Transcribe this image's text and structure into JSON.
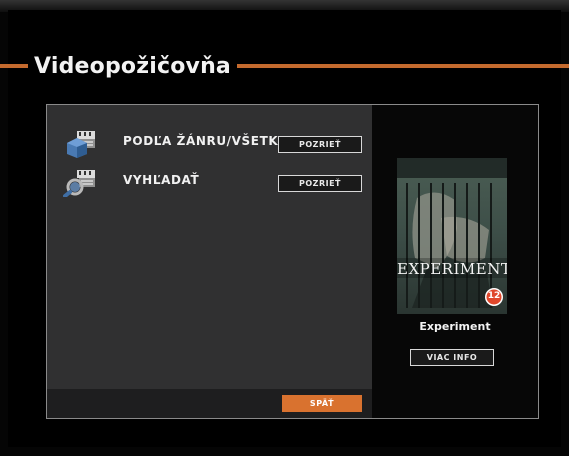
{
  "app": {
    "title": "Videopožičovňa"
  },
  "menu": {
    "items": [
      {
        "label": "PODĽA ŽÁNRU/VŠETKO",
        "button": "POZRIEŤ",
        "icon": "film-genre-icon"
      },
      {
        "label": "VYHĽADAŤ",
        "button": "POZRIEŤ",
        "icon": "film-search-icon"
      }
    ]
  },
  "footer": {
    "back_label": "SPÄŤ"
  },
  "preview": {
    "poster_title": "EXPERIMENT",
    "age_rating": "12",
    "movie_name": "Experiment",
    "more_info_label": "VIAC INFO"
  },
  "colors": {
    "accent": "#c46a2e",
    "button_orange": "#d9722f",
    "panel": "#303031",
    "background": "#050505"
  }
}
